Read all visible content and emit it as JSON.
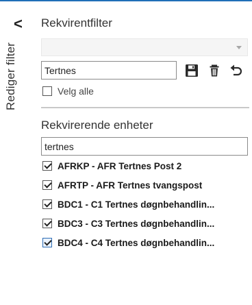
{
  "panel": {
    "vertical_title": "Rediger filter",
    "collapse_glyph": "<",
    "colors": {
      "accent": "#1f6fb8",
      "divider": "#c8c8c8"
    }
  },
  "filter": {
    "heading": "Rekvirentfilter",
    "dropdown_value": "",
    "name_value": "Tertnes",
    "actions": [
      "save-icon",
      "trash-icon",
      "undo-icon"
    ],
    "select_all_label": "Velg alle",
    "select_all_checked": false
  },
  "units": {
    "heading": "Rekvirerende enheter",
    "search_value": "tertnes",
    "items": [
      {
        "label": "AFRKP - AFR Tertnes Post 2",
        "checked": true
      },
      {
        "label": "AFRTP - AFR Tertnes tvangspost",
        "checked": true
      },
      {
        "label": "BDC1 - C1 Tertnes døgnbehandlin...",
        "checked": true
      },
      {
        "label": "BDC3 - C3 Tertnes døgnbehandlin...",
        "checked": true
      },
      {
        "label": "BDC4 - C4 Tertnes døgnbehandlin...",
        "checked": true
      }
    ]
  }
}
